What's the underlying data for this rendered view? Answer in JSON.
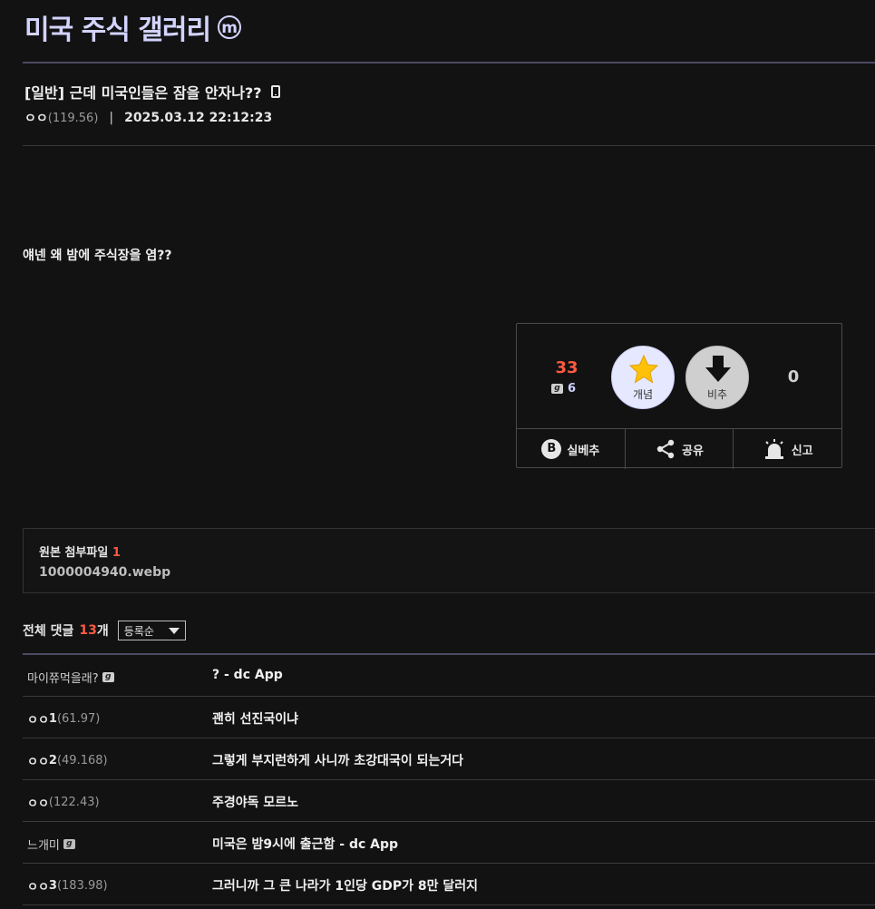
{
  "gallery": {
    "title": "미국 주식 갤러리",
    "badge": "m"
  },
  "post": {
    "title": "[일반] 근데 미국인들은 잠을 안자나??",
    "nickname": "ㅇㅇ",
    "ip": "(119.56)",
    "separator": "|",
    "date": "2025.03.12 22:12:23",
    "body": "얘넨 왜 밤에 주식장을 염??"
  },
  "vote": {
    "up_count": "33",
    "fix_count": "6",
    "up_label": "개념",
    "down_label": "비추",
    "down_count": "0",
    "actions": [
      {
        "icon": "b-icon",
        "label": "실베추",
        "glyph": "B"
      },
      {
        "icon": "share-icon",
        "label": "공유"
      },
      {
        "icon": "siren-icon",
        "label": "신고"
      }
    ]
  },
  "attachment": {
    "title": "원본 첨부파일",
    "count": "1",
    "file": "1000004940.webp"
  },
  "comments": {
    "label": "전체 댓글",
    "count": "13",
    "unit": "개",
    "sort": "등록순",
    "items": [
      {
        "nick": "마이쮸먹을래?",
        "nick_bold": "",
        "ip": "",
        "badge": "fixed",
        "text": "? - dc App"
      },
      {
        "nick": "ㅇㅇ",
        "nick_bold": "1",
        "ip": "(61.97)",
        "badge": "",
        "text": "괜히 선진국이냐"
      },
      {
        "nick": "ㅇㅇ",
        "nick_bold": "2",
        "ip": "(49.168)",
        "badge": "",
        "text": "그렇게 부지런하게 사니까 초강대국이 되는거다"
      },
      {
        "nick": "ㅇㅇ",
        "nick_bold": "",
        "ip": "(122.43)",
        "badge": "",
        "text": "주경야독 모르노"
      },
      {
        "nick": "느개미",
        "nick_bold": "",
        "ip": "",
        "badge": "semi",
        "text": "미국은 밤9시에 출근함 - dc App"
      },
      {
        "nick": "ㅇㅇ",
        "nick_bold": "3",
        "ip": "(183.98)",
        "badge": "",
        "text": "그러니까 그 큰 나라가 1인당 GDP가 8만 달러지"
      }
    ]
  }
}
